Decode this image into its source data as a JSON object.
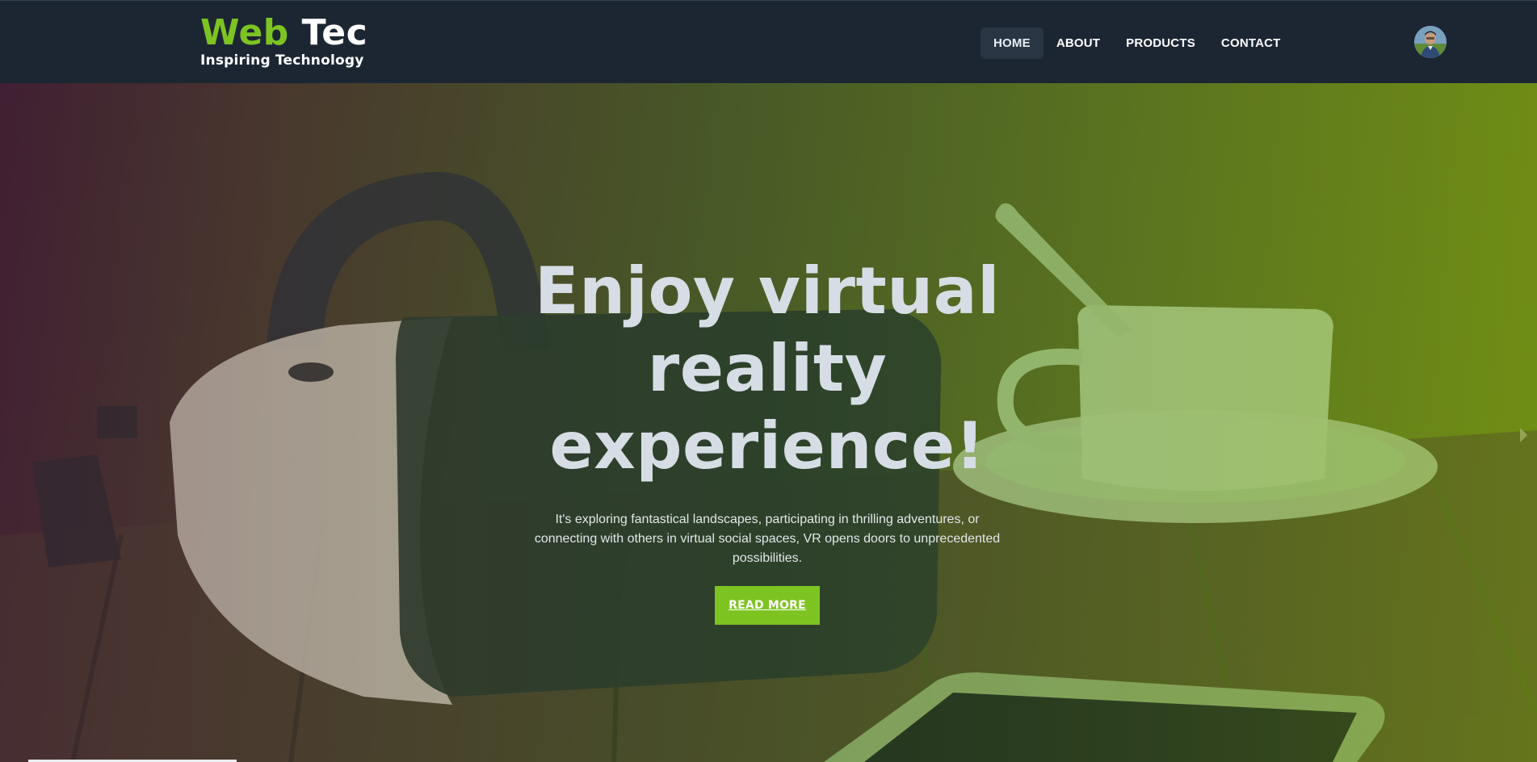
{
  "brand": {
    "name_part1": "Web",
    "name_part2": " Tec",
    "tagline": "Inspiring Technology",
    "accent_color": "#7dc422",
    "nav_bg_color": "#1c2633"
  },
  "nav": {
    "items": [
      {
        "label": "HOME",
        "active": true
      },
      {
        "label": "ABOUT",
        "active": false
      },
      {
        "label": "PRODUCTS",
        "active": false
      },
      {
        "label": "CONTACT",
        "active": false
      }
    ]
  },
  "user": {
    "avatar_icon": "user-avatar-photo"
  },
  "hero": {
    "title": "Enjoy virtual reality experience!",
    "text": "It's exploring fantastical landscapes, participating in thrilling adventures, or connecting with others in virtual social spaces, VR opens doors to unprecedented possibilities.",
    "button_label": "READ MORE",
    "next_icon": "chevron-right-icon"
  }
}
